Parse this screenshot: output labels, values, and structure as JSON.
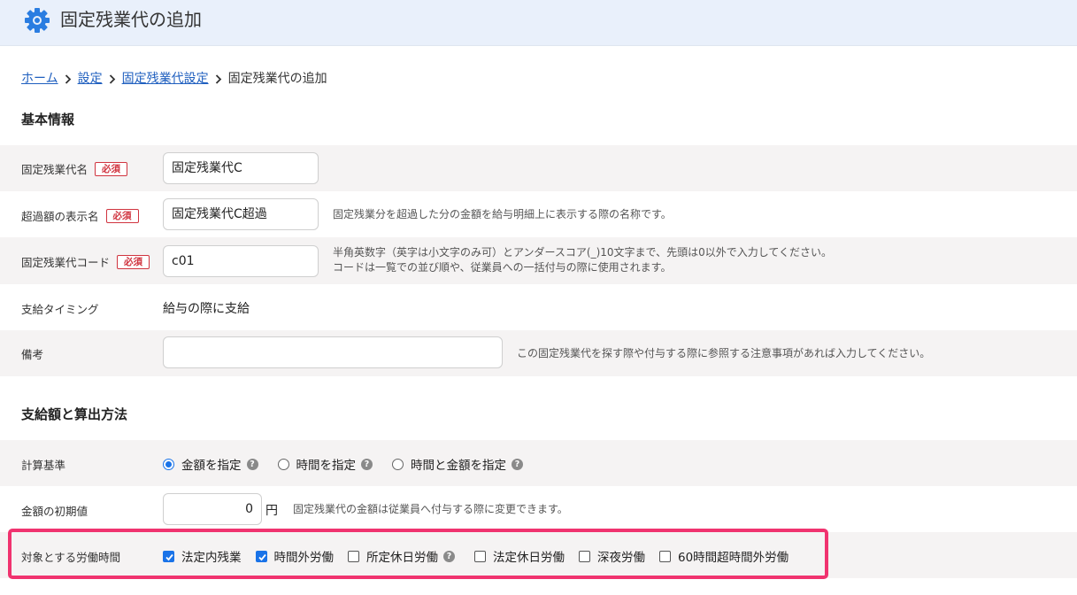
{
  "header": {
    "title": "固定残業代の追加",
    "icon": "gear-icon"
  },
  "breadcrumb": {
    "items": [
      "ホーム",
      "設定",
      "固定残業代設定"
    ],
    "current": "固定残業代の追加"
  },
  "basic": {
    "section_title": "基本情報",
    "name": {
      "label": "固定残業代名",
      "required": "必須",
      "value": "固定残業代C"
    },
    "display_name": {
      "label": "超過額の表示名",
      "required": "必須",
      "value": "固定残業代C超過",
      "hint": "固定残業分を超過した分の金額を給与明細上に表示する際の名称です。"
    },
    "code": {
      "label": "固定残業代コード",
      "required": "必須",
      "value": "c01",
      "hint_line1": "半角英数字（英字は小文字のみ可）とアンダースコア(_)10文字まで、先頭は0以外で入力してください。",
      "hint_line2": "コードは一覧での並び順や、従業員への一括付与の際に使用されます。"
    },
    "timing": {
      "label": "支給タイミング",
      "value": "給与の際に支給"
    },
    "note": {
      "label": "備考",
      "value": "",
      "hint": "この固定残業代を探す際や付与する際に参照する注意事項があれば入力してください。"
    }
  },
  "calc": {
    "section_title": "支給額と算出方法",
    "basis": {
      "label": "計算基準",
      "options": [
        "金額を指定",
        "時間を指定",
        "時間と金額を指定"
      ],
      "selected": "金額を指定"
    },
    "initial_amount": {
      "label": "金額の初期値",
      "value": "0",
      "unit": "円",
      "hint": "固定残業代の金額は従業員へ付与する際に変更できます。"
    },
    "target_hours": {
      "label": "対象とする労働時間",
      "options": [
        {
          "label": "法定内残業",
          "checked": true
        },
        {
          "label": "時間外労働",
          "checked": true
        },
        {
          "label": "所定休日労働",
          "checked": false
        },
        {
          "label": "法定休日労働",
          "checked": false
        },
        {
          "label": "深夜労働",
          "checked": false
        },
        {
          "label": "60時間超時間外労働",
          "checked": false
        }
      ]
    }
  },
  "colors": {
    "accent": "#1a73e8",
    "link": "#1f5fbf",
    "required": "#d0343f",
    "highlight": "#f0336f",
    "header_bg": "#e9f0fb",
    "row_shade": "#f5f3f3"
  }
}
